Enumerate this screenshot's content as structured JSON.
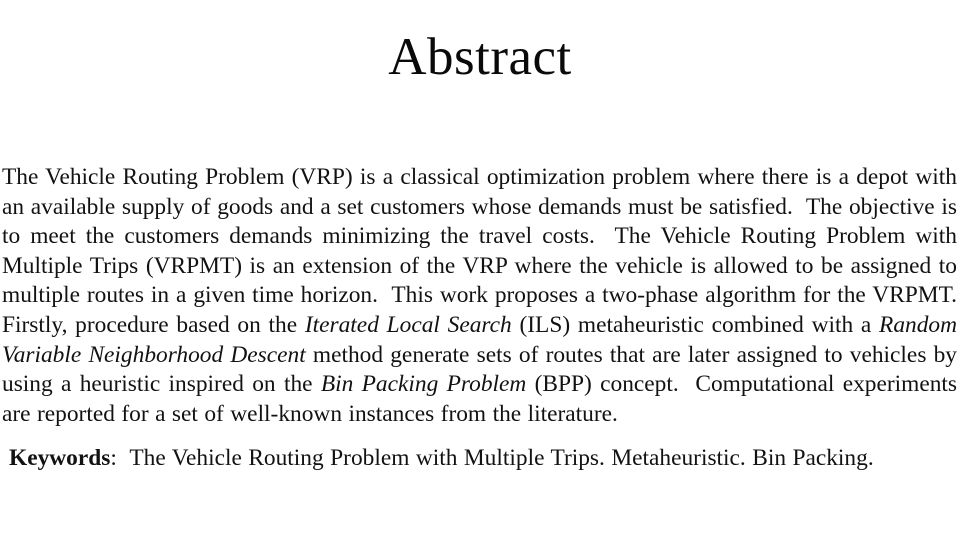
{
  "document": {
    "title": "Abstract",
    "section_heading": "Abstract",
    "text_color": "#121212",
    "background_color": "#ffffff"
  },
  "abstract": {
    "segments": [
      {
        "style": "roman",
        "text": "The Vehicle Routing Problem (VRP) is a classical optimization problem where there is a depot with an available supply of goods and a set customers whose demands must be satisfied."
      },
      {
        "style": "space",
        "text": "  "
      },
      {
        "style": "roman",
        "text": "The objective is to meet the customers demands minimizing the travel costs."
      },
      {
        "style": "space",
        "text": "  "
      },
      {
        "style": "roman",
        "text": "The Vehicle Routing Problem with Multiple Trips (VRPMT) is an extension of the VRP where the vehicle is allowed to be assigned to multiple routes in a given time horizon."
      },
      {
        "style": "space",
        "text": "  "
      },
      {
        "style": "roman",
        "text": "This work proposes a two-phase algorithm for the VRPMT. Firstly, procedure based on the "
      },
      {
        "style": "italic",
        "text": "Iterated Local Search"
      },
      {
        "style": "roman",
        "text": " (ILS) metaheuristic combined with a "
      },
      {
        "style": "italic",
        "text": "Random Variable Neighborhood Descent"
      },
      {
        "style": "roman",
        "text": " method generate sets of routes that are later assigned to vehicles by using a heuristic inspired on the "
      },
      {
        "style": "italic",
        "text": "Bin Packing Problem"
      },
      {
        "style": "roman",
        "text": " (BPP) concept."
      },
      {
        "style": "space",
        "text": "  "
      },
      {
        "style": "roman",
        "text": "Computational experiments are reported for a set of well-known instances from the literature."
      }
    ],
    "full_text": "The Vehicle Routing Problem (VRP) is a classical optimization problem where there is a depot with an available supply of goods and a set customers whose demands must be satisfied. The objective is to meet the customers demands minimizing the travel costs. The Vehicle Routing Problem with Multiple Trips (VRPMT) is an extension of the VRP where the vehicle is allowed to be assigned to multiple routes in a given time horizon. This work proposes a two-phase algorithm for the VRPMT. Firstly, procedure based on the Iterated Local Search (ILS) metaheuristic combined with a Random Variable Neighborhood Descent method generate sets of routes that are later assigned to vehicles by using a heuristic inspired on the Bin Packing Problem (BPP) concept. Computational experiments are reported for a set of well-known instances from the literature."
  },
  "keywords": {
    "label": "Keywords",
    "separator": ":",
    "items": [
      "The Vehicle Routing Problem with Multiple Trips.",
      "Metaheuristic.",
      "Bin Packing."
    ],
    "full_text": "The Vehicle Routing Problem with Multiple Trips.  Metaheuristic.  Bin Packing."
  }
}
